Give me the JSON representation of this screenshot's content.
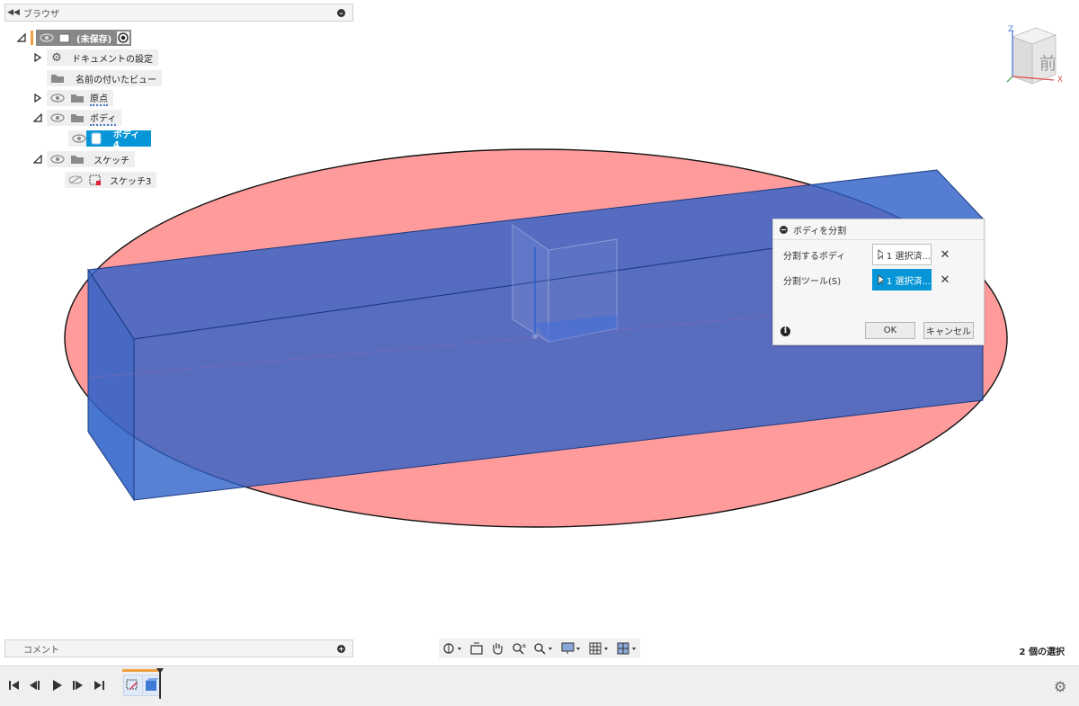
{
  "browser": {
    "title": "ブラウザ",
    "root_label": "(未保存)",
    "items": [
      {
        "label": "ドキュメントの設定"
      },
      {
        "label": "名前の付いたビュー"
      },
      {
        "label": "原点"
      },
      {
        "label": "ボディ"
      },
      {
        "label": "ボディ4"
      },
      {
        "label": "スケッチ"
      },
      {
        "label": "スケッチ3"
      }
    ]
  },
  "dialog": {
    "title": "ボディを分割",
    "rows": [
      {
        "label": "分割するボディ",
        "button": "1 選択済み",
        "button_display": "1 選択済..."
      },
      {
        "label": "分割ツール(S)",
        "button": "1 選択済み",
        "button_display": "1 選択済..."
      }
    ],
    "ok": "OK",
    "cancel": "キャンセル"
  },
  "viewcube": {
    "face": "前",
    "axis_z": "Z",
    "axis_x": "X"
  },
  "comments": {
    "title": "コメント"
  },
  "status": {
    "selection": "2 個の選択"
  },
  "colors": {
    "accent": "#0696d7",
    "body": "#2f62c8",
    "plane": "#ff8f8f"
  },
  "icons": {
    "navbar": [
      "orbit-icon",
      "look-at-icon",
      "pan-icon",
      "zoom-icon",
      "fit-icon",
      "display-icon",
      "grid-icon",
      "viewports-icon"
    ],
    "timeline": [
      "first-icon",
      "previous-icon",
      "play-icon",
      "next-icon",
      "last-icon",
      "settings-icon"
    ]
  }
}
